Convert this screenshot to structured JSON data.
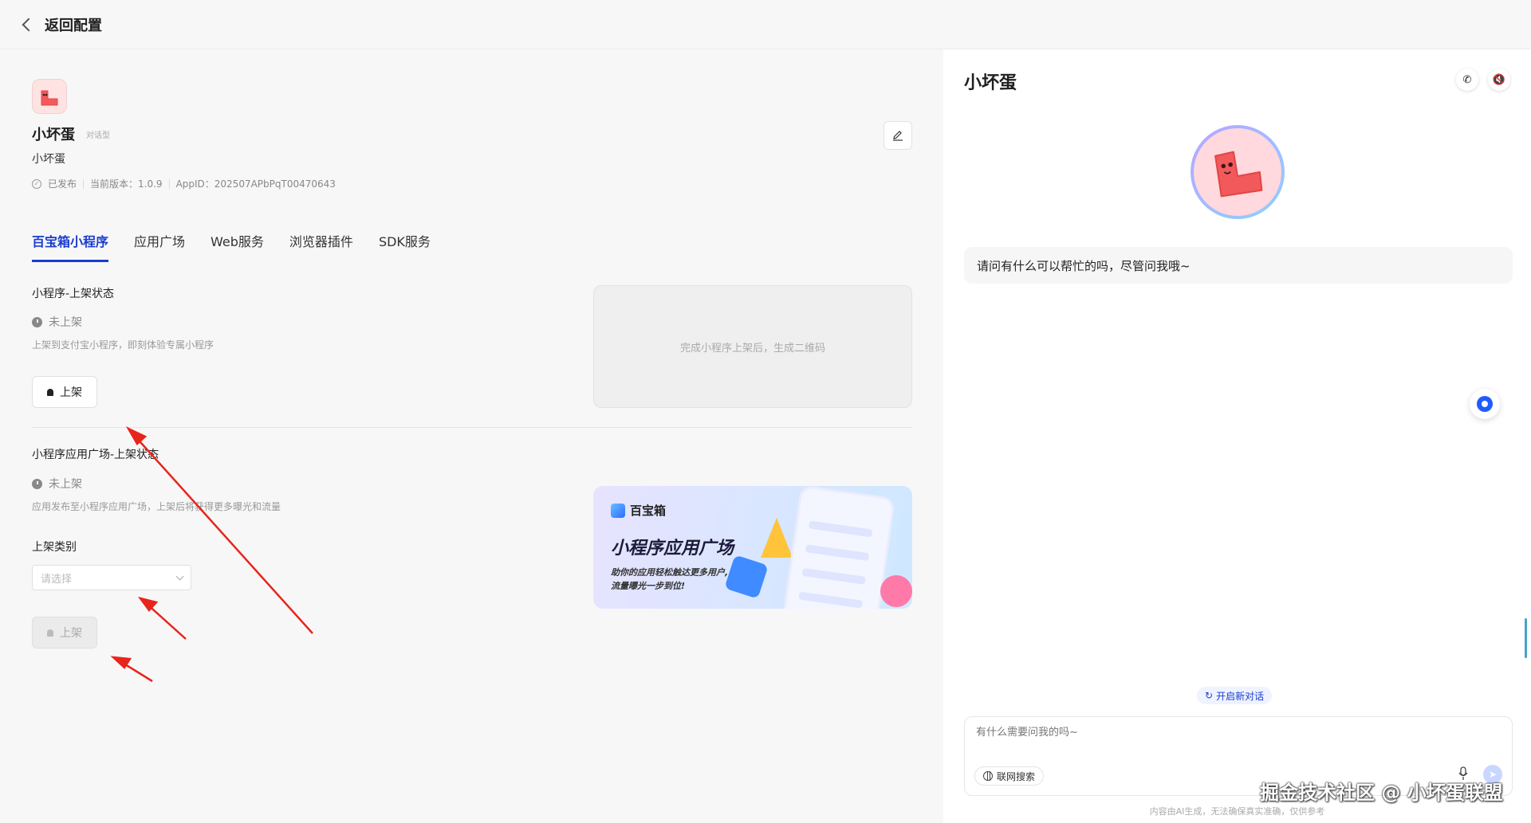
{
  "topbar": {
    "back_label": "返回配置"
  },
  "app": {
    "name": "小坏蛋",
    "type_tag": "对话型",
    "description": "小坏蛋",
    "published": "已发布",
    "version": "当前版本：1.0.9",
    "app_id": "AppID：202507APbPqT00470643"
  },
  "tabs": [
    {
      "label": "百宝箱小程序"
    },
    {
      "label": "应用广场"
    },
    {
      "label": "Web服务"
    },
    {
      "label": "浏览器插件"
    },
    {
      "label": "SDK服务"
    }
  ],
  "mini_program": {
    "title": "小程序-上架状态",
    "status": "未上架",
    "hint": "上架到支付宝小程序，即刻体验专属小程序",
    "button": "上架",
    "qr_placeholder": "完成小程序上架后，生成二维码"
  },
  "square": {
    "title": "小程序应用广场-上架状态",
    "status": "未上架",
    "hint": "应用发布至小程序应用广场，上架后将获得更多曝光和流量",
    "category_label": "上架类别",
    "category_placeholder": "请选择",
    "button": "上架"
  },
  "banner": {
    "brand": "百宝箱",
    "title": "小程序应用广场",
    "subtitle_line1": "助你的应用轻松触达更多用户,",
    "subtitle_line2": "流量曝光一步到位!"
  },
  "chat": {
    "title": "小坏蛋",
    "greeting": "请问有什么可以帮忙的吗，尽管问我哦~",
    "new_chat": "开启新对话",
    "input_placeholder": "有什么需要问我的吗~",
    "web_search": "联网搜索",
    "disclaimer": "内容由AI生成，无法确保真实准确，仅供参考"
  },
  "watermark": "掘金技术社区 @ 小坏蛋联盟",
  "colors": {
    "accent": "#1a3ccf",
    "annotation_arrow": "#e8251b"
  }
}
